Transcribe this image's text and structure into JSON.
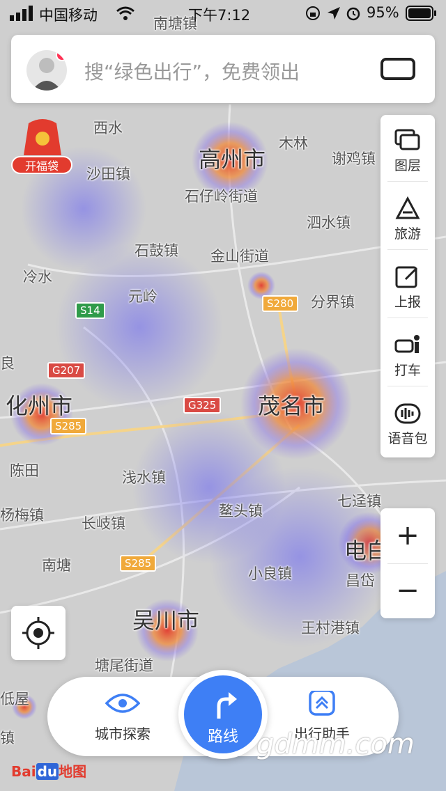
{
  "status_bar": {
    "carrier": "中国移动",
    "time": "下午7:12",
    "battery": "95%"
  },
  "search": {
    "placeholder": "搜“绿色出行”，免费领出"
  },
  "fudai_label": "开福袋",
  "toolbar": [
    {
      "label": "图层",
      "icon": "layers-icon"
    },
    {
      "label": "旅游",
      "icon": "travel-icon"
    },
    {
      "label": "上报",
      "icon": "report-icon"
    },
    {
      "label": "打车",
      "icon": "taxi-icon"
    },
    {
      "label": "语音包",
      "icon": "voice-pack-icon"
    }
  ],
  "zoom": {
    "in": "+",
    "out": "−"
  },
  "bottom_nav": {
    "explore": "城市探索",
    "route": "路线",
    "assistant": "出行助手"
  },
  "brand": {
    "bai": "Bai",
    "du": "du",
    "map": "地图"
  },
  "watermark": "gdmm.com",
  "map_labels": {
    "nantang_top": "南塘镇",
    "xishui": "西水",
    "gaozhou": "高州市",
    "mulin": "木林",
    "xiejizhen": "谢鸡镇",
    "shatian": "沙田镇",
    "shizailing": "石仔岭街道",
    "sishui": "泗水镇",
    "shigu": "石鼓镇",
    "jinshan": "金山街道",
    "lengshui": "冷水",
    "yuanling": "元岭",
    "fenjie": "分界镇",
    "liang": "良",
    "huazhou": "化州市",
    "maoming": "茂名市",
    "chentian": "陈田",
    "qianshui": "浅水镇",
    "qijing": "七迳镇",
    "yangmei": "杨梅镇",
    "changqi": "长岐镇",
    "aotou": "鳌头镇",
    "dianbai": "电白",
    "nantang": "南塘",
    "xiaoliang": "小良镇",
    "changdai": "昌岱",
    "wuchuan": "吴川市",
    "wangcungang": "王村港镇",
    "tangwei": "塘尾街道",
    "diwu": "低屋",
    "zhen": "镇"
  },
  "road_shields": {
    "s14": "S14",
    "s280": "S280",
    "g207": "G207",
    "g325": "G325",
    "s285a": "S285",
    "s285b": "S285"
  }
}
